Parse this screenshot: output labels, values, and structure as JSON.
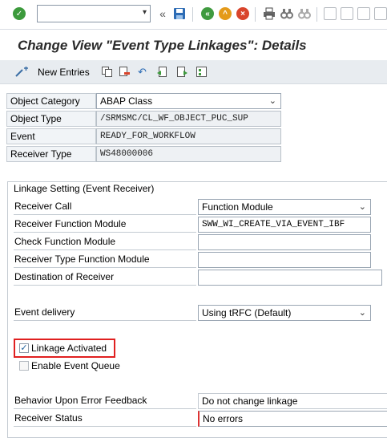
{
  "toolbar": {
    "command_value": "",
    "icons": [
      "enter-icon",
      "history-dropdown-icon",
      "double-left-icon",
      "save-icon",
      "back-icon",
      "exit-icon",
      "cancel-icon",
      "print-icon",
      "find-icon",
      "find-next-icon",
      "first-page-icon",
      "prev-page-icon",
      "next-page-icon",
      "last-page-icon"
    ]
  },
  "title": "Change View \"Event Type Linkages\": Details",
  "app_toolbar": {
    "new_entries_label": "New Entries"
  },
  "header_fields": {
    "object_category_label": "Object Category",
    "object_category_value": "ABAP Class",
    "object_type_label": "Object Type",
    "object_type_value": "/SRMSMC/CL_WF_OBJECT_PUC_SUP",
    "event_label": "Event",
    "event_value": "READY_FOR_WORKFLOW",
    "receiver_type_label": "Receiver Type",
    "receiver_type_value": "WS48000006"
  },
  "linkage": {
    "section_title": "Linkage Setting (Event Receiver)",
    "receiver_call_label": "Receiver Call",
    "receiver_call_value": "Function Module",
    "receiver_fm_label": "Receiver Function Module",
    "receiver_fm_value": "SWW_WI_CREATE_VIA_EVENT_IBF",
    "check_fm_label": "Check Function Module",
    "check_fm_value": "",
    "receiver_type_fm_label": "Receiver Type Function Module",
    "receiver_type_fm_value": "",
    "destination_label": "Destination of Receiver",
    "destination_value": "",
    "event_delivery_label": "Event delivery",
    "event_delivery_value": "Using tRFC (Default)",
    "linkage_activated_label": "Linkage Activated",
    "linkage_activated_checked": true,
    "enable_queue_label": "Enable Event Queue",
    "enable_queue_checked": false,
    "error_feedback_label": "Behavior Upon Error Feedback",
    "error_feedback_value": "Do not change linkage",
    "receiver_status_label": "Receiver Status",
    "receiver_status_value": "No errors"
  },
  "colors": {
    "highlight_border": "#e02020",
    "enter_green": "#3c9a3c",
    "save_blue": "#2d6cb5",
    "back_green": "#3f9a3f",
    "exit_orange": "#e49a1a",
    "cancel_red": "#d9442b"
  }
}
